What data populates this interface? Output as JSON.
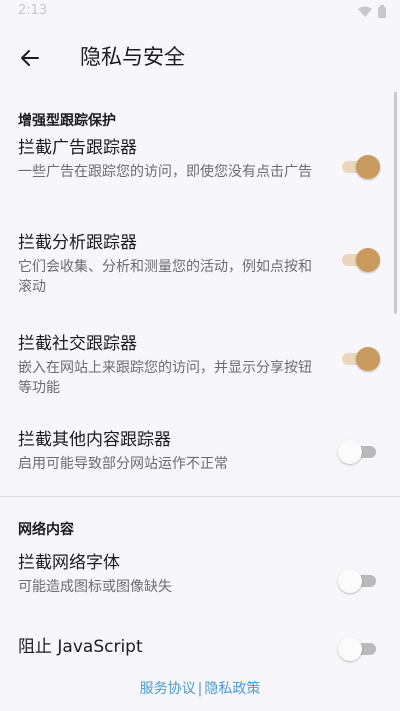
{
  "status": {
    "time": "2:13"
  },
  "header": {
    "title": "隐私与安全",
    "back_icon": "arrow-left-icon"
  },
  "sections": [
    {
      "title": "增强型跟踪保护",
      "items": [
        {
          "title": "拦截广告跟踪器",
          "summary": "一些广告在跟踪您的访问，即使您没有点击广告",
          "enabled": true
        },
        {
          "title": "拦截分析跟踪器",
          "summary": "它们会收集、分析和测量您的活动，例如点按和滚动",
          "enabled": true
        },
        {
          "title": "拦截社交跟踪器",
          "summary": "嵌入在网站上来跟踪您的访问，并显示分享按钮等功能",
          "enabled": true
        },
        {
          "title": "拦截其他内容跟踪器",
          "summary": "启用可能导致部分网站运作不正常",
          "enabled": false
        }
      ]
    },
    {
      "title": "网络内容",
      "items": [
        {
          "title": "拦截网络字体",
          "summary": "可能造成图标或图像缺失",
          "enabled": false
        },
        {
          "title": "阻止 JavaScript",
          "summary": "",
          "enabled": false
        }
      ]
    }
  ],
  "footer": {
    "terms": "服务协议",
    "separator": "|",
    "privacy": "隐私政策"
  },
  "colors": {
    "accent": "#c89a5e",
    "link": "#4a9bd6",
    "background": "#f7f6fa"
  }
}
